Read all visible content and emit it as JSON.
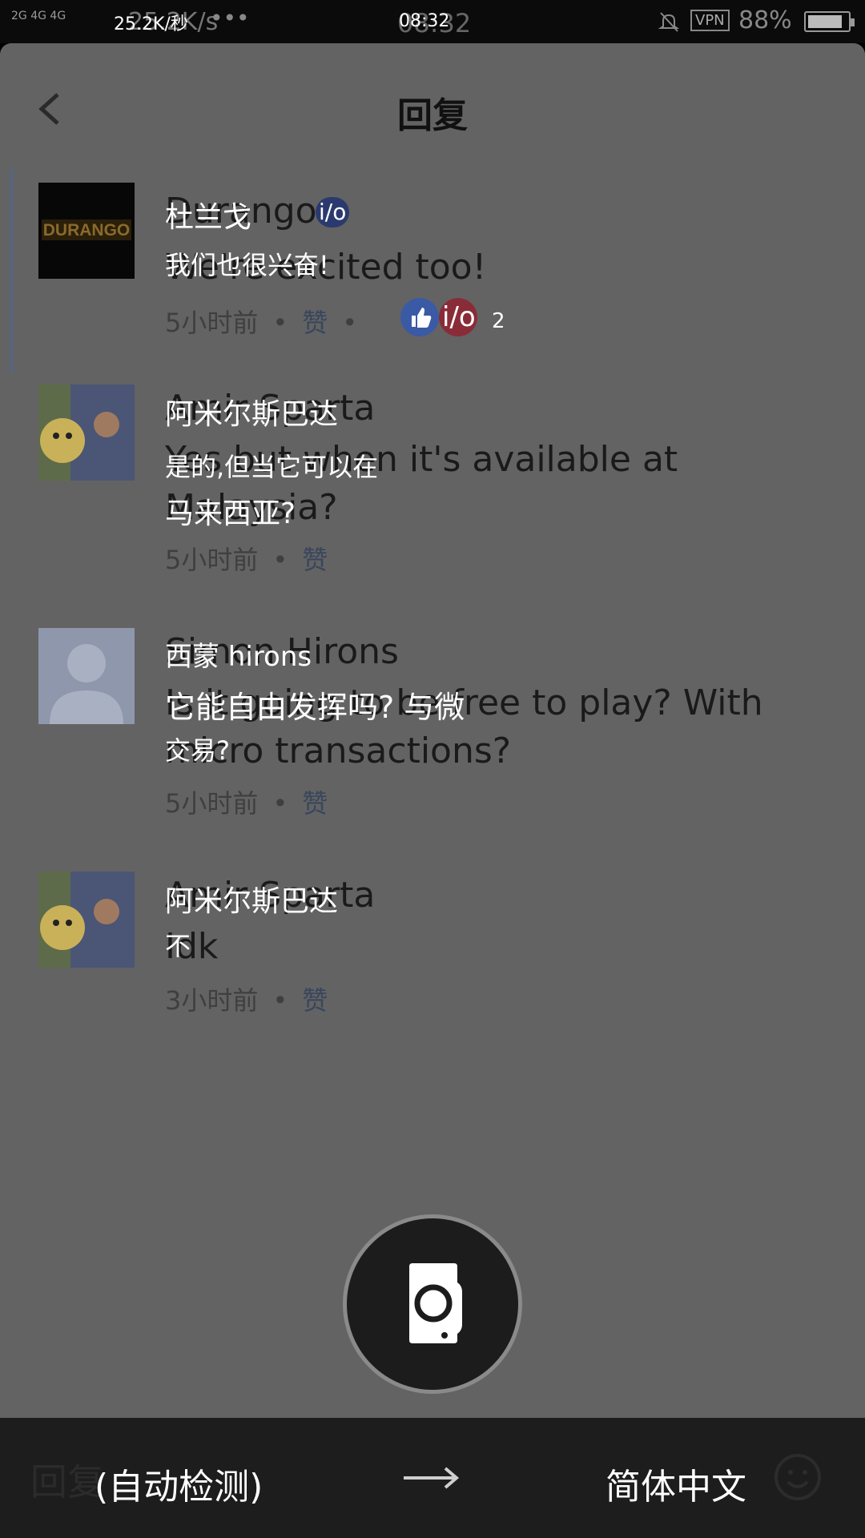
{
  "status_bar": {
    "signal": "2G 4G 4G",
    "speed": "25.2K/秒",
    "speed_ghost": "25.2K/s",
    "dots": "•••",
    "time": "08:32",
    "time_ghost": "08:32",
    "vpn": "VPN",
    "battery": "88%",
    "battery_level": 0.88
  },
  "header": {
    "title": "回复"
  },
  "comments": [
    {
      "author": "Durango",
      "author_tr": "杜兰戈",
      "badge": "i/o",
      "text": "We're excited too!",
      "text_tr": "我们也很兴奋!",
      "time": "5小时前",
      "like": "赞",
      "reaction_count": "2",
      "reaction_badge": "i/o"
    },
    {
      "author": "Amir Sparta",
      "author_tr": "阿米尔斯巴达",
      "text": "Yes but when it's available at Malaysia?",
      "text_tr_1": "是的,但当它可以在",
      "text_tr_2": "马来西亚?",
      "time": "5小时前",
      "like": "赞"
    },
    {
      "author": "Simon Hirons",
      "author_tr": "西蒙 hirons",
      "text": "Is it going to be free to play? With micro transactions?",
      "text_tr_1": "它能自由发挥吗? 与微",
      "text_tr_2": "交易?",
      "time": "5小时前",
      "like": "赞"
    },
    {
      "author": "Amir Sparta",
      "author_tr": "阿米尔斯巴达",
      "text": "Idk",
      "text_tr": "不",
      "time": "3小时前",
      "like": "赞"
    }
  ],
  "translation_bar": {
    "reply_placeholder": "回复",
    "source_language": "(自动检测)",
    "target_language": "简体中文"
  },
  "colors": {
    "overlay": "#636363",
    "bar": "#1d1d1d",
    "accent": "#59657a"
  },
  "icons": [
    "back-arrow-icon",
    "camera-icon",
    "arrow-right-icon",
    "smile-icon",
    "bell-off-icon",
    "battery-icon",
    "like-icon"
  ]
}
